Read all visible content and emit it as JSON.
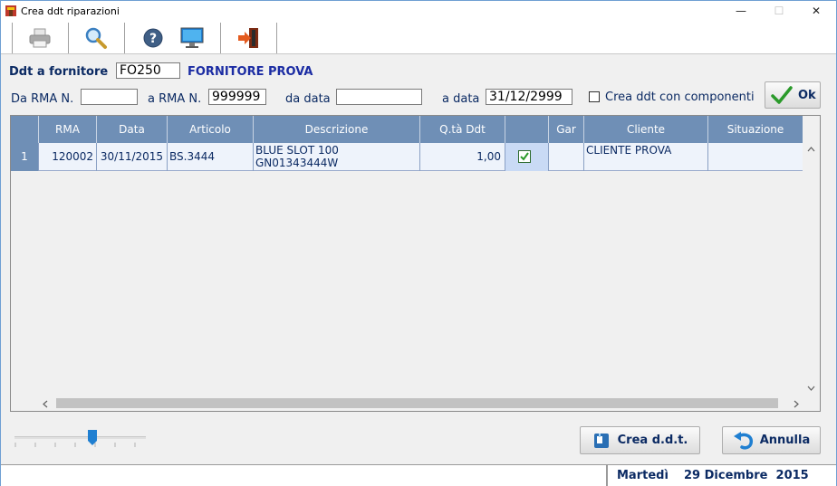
{
  "window": {
    "title": "Crea ddt riparazioni",
    "minimize": "—",
    "maximize": "☐",
    "close": "✕"
  },
  "toolbar": {
    "icons": [
      "printer-icon",
      "search-icon",
      "help-icon",
      "monitor-icon",
      "exit-icon"
    ]
  },
  "form": {
    "supplier_label": "Ddt a fornitore",
    "supplier_code": "FO250",
    "supplier_name": "FORNITORE PROVA",
    "rma_from_label": "Da RMA N.",
    "rma_from_value": "",
    "rma_to_label": "a RMA N.",
    "rma_to_value": "999999",
    "date_from_label": "da data",
    "date_from_value": "",
    "date_to_label": "a data",
    "date_to_value": "31/12/2999",
    "components_label": "Crea ddt con componenti",
    "components_checked": false,
    "ok_label": "Ok"
  },
  "table": {
    "columns": [
      "",
      "RMA",
      "Data",
      "Articolo",
      "Descrizione",
      "Q.tà Ddt",
      "",
      "Gar",
      "Cliente",
      "Situazione"
    ],
    "rows": [
      {
        "num": "1",
        "rma": "120002",
        "data": "30/11/2015",
        "articolo": "BS.3444",
        "descrizione_1": "BLUE SLOT 100",
        "descrizione_2": "GN01343444W",
        "qta": "1,00",
        "selected": true,
        "gar": "",
        "cliente": "CLIENTE PROVA",
        "situazione": ""
      }
    ]
  },
  "zoom": {
    "level": 0.6
  },
  "buttons": {
    "create_label": "Crea d.d.t.",
    "cancel_label": "Annulla"
  },
  "status": {
    "day": "Martedì",
    "date": "29 Dicembre  2015"
  }
}
